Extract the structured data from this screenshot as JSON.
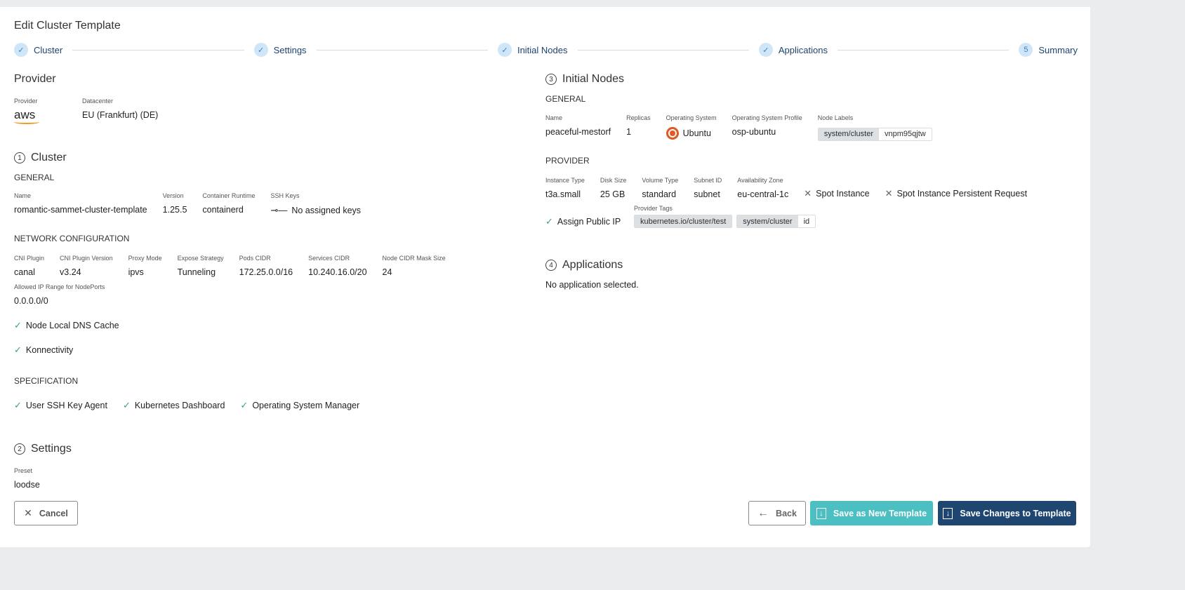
{
  "title": "Edit Cluster Template",
  "steps": [
    {
      "label": "Cluster",
      "state": "done"
    },
    {
      "label": "Settings",
      "state": "done"
    },
    {
      "label": "Initial Nodes",
      "state": "done"
    },
    {
      "label": "Applications",
      "state": "done"
    },
    {
      "label": "Summary",
      "state": "current",
      "number": "5"
    }
  ],
  "provider": {
    "heading": "Provider",
    "provider_label": "Provider",
    "provider_value": "aws",
    "datacenter_label": "Datacenter",
    "datacenter_value": "EU (Frankfurt) (DE)"
  },
  "cluster": {
    "number": "1",
    "heading": "Cluster",
    "general": "GENERAL",
    "fields": [
      {
        "label": "Name",
        "value": "romantic-sammet-cluster-template"
      },
      {
        "label": "Version",
        "value": "1.25.5"
      },
      {
        "label": "Container Runtime",
        "value": "containerd"
      },
      {
        "label": "SSH Keys",
        "value": "No assigned keys"
      }
    ],
    "network": "NETWORK CONFIGURATION",
    "net_fields": [
      {
        "label": "CNI Plugin",
        "value": "canal"
      },
      {
        "label": "CNI Plugin Version",
        "value": "v3.24"
      },
      {
        "label": "Proxy Mode",
        "value": "ipvs"
      },
      {
        "label": "Expose Strategy",
        "value": "Tunneling"
      },
      {
        "label": "Pods CIDR",
        "value": "172.25.0.0/16"
      },
      {
        "label": "Services CIDR",
        "value": "10.240.16.0/20"
      },
      {
        "label": "Node CIDR Mask Size",
        "value": "24"
      }
    ],
    "allowed_label": "Allowed IP Range for NodePorts",
    "allowed_value": "0.0.0.0/0",
    "checks": [
      "Node Local DNS Cache",
      "Konnectivity"
    ],
    "spec": "SPECIFICATION",
    "spec_checks": [
      "User SSH Key Agent",
      "Kubernetes Dashboard",
      "Operating System Manager"
    ]
  },
  "settings": {
    "number": "2",
    "heading": "Settings",
    "preset_label": "Preset",
    "preset_value": "loodse"
  },
  "nodes": {
    "number": "3",
    "heading": "Initial Nodes",
    "general": "GENERAL",
    "fields": [
      {
        "label": "Name",
        "value": "peaceful-mestorf"
      },
      {
        "label": "Replicas",
        "value": "1"
      },
      {
        "label": "Operating System",
        "value": "Ubuntu"
      },
      {
        "label": "Operating System Profile",
        "value": "osp-ubuntu"
      }
    ],
    "labels_label": "Node Labels",
    "label_key": "system/cluster",
    "label_value": "vnpm95qjtw",
    "provider": "PROVIDER",
    "prov_fields": [
      {
        "label": "Instance Type",
        "value": "t3a.small"
      },
      {
        "label": "Disk Size",
        "value": "25 GB"
      },
      {
        "label": "Volume Type",
        "value": "standard"
      },
      {
        "label": "Subnet ID",
        "value": "subnet"
      },
      {
        "label": "Availability Zone",
        "value": "eu-central-1c"
      }
    ],
    "spot": "Spot Instance",
    "spot_persist": "Spot Instance Persistent Request",
    "public_ip": "Assign Public IP",
    "tags_label": "Provider Tags",
    "tag1": "kubernetes.io/cluster/test",
    "tag2_key": "system/cluster",
    "tag2_value": "id"
  },
  "apps": {
    "number": "4",
    "heading": "Applications",
    "empty": "No application selected."
  },
  "buttons": {
    "cancel": "Cancel",
    "back": "Back",
    "save_new": "Save as New Template",
    "save_changes": "Save Changes to Template"
  },
  "colors": {
    "primary": "#1f4670",
    "teal": "#4bbfc1",
    "check": "#3aa76d",
    "step_bg": "#cfe6f9"
  }
}
